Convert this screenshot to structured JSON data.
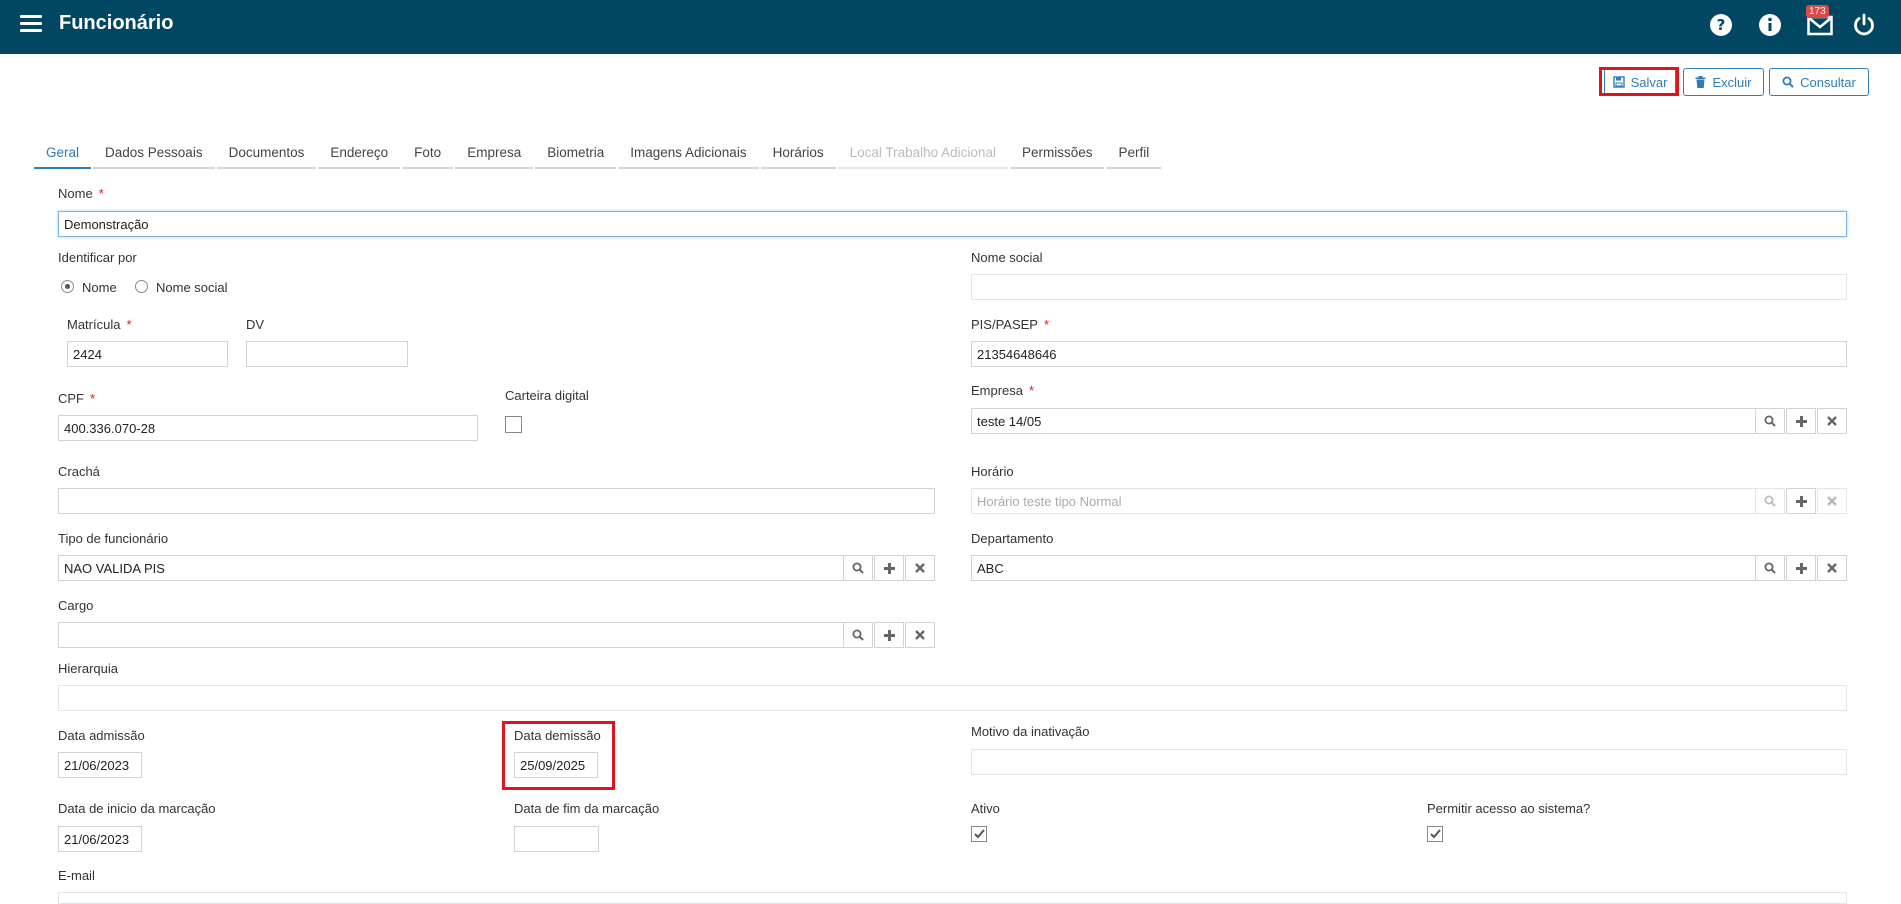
{
  "header": {
    "title": "Funcionário",
    "notifications_count": "173"
  },
  "toolbar": {
    "save_label": "Salvar",
    "delete_label": "Excluir",
    "search_label": "Consultar"
  },
  "tabs": [
    "Geral",
    "Dados Pessoais",
    "Documentos",
    "Endereço",
    "Foto",
    "Empresa",
    "Biometria",
    "Imagens Adicionais",
    "Horários",
    "Local Trabalho Adicional",
    "Permissões",
    "Perfil"
  ],
  "form": {
    "nome": {
      "label": "Nome",
      "value": "Demonstração"
    },
    "identificar_por": {
      "label": "Identificar por",
      "option_nome": "Nome",
      "option_social": "Nome social"
    },
    "nome_social": {
      "label": "Nome social",
      "value": ""
    },
    "matricula": {
      "label": "Matrícula",
      "value": "2424"
    },
    "dv": {
      "label": "DV",
      "value": ""
    },
    "pis": {
      "label": "PIS/PASEP",
      "value": "21354648646"
    },
    "cpf": {
      "label": "CPF",
      "value": "400.336.070-28"
    },
    "carteira": {
      "label": "Carteira digital"
    },
    "empresa": {
      "label": "Empresa",
      "value": "teste 14/05"
    },
    "cracha": {
      "label": "Crachá",
      "value": ""
    },
    "horario": {
      "label": "Horário",
      "value": "Horário teste tipo Normal"
    },
    "tipo": {
      "label": "Tipo de funcionário",
      "value": "NAO VALIDA PIS"
    },
    "departamento": {
      "label": "Departamento",
      "value": "ABC"
    },
    "cargo": {
      "label": "Cargo",
      "value": ""
    },
    "hierarquia": {
      "label": "Hierarquia",
      "value": ""
    },
    "admissao": {
      "label": "Data admissão",
      "value": "21/06/2023"
    },
    "demissao": {
      "label": "Data demissão",
      "value": "25/09/2025"
    },
    "motivo": {
      "label": "Motivo da inativação",
      "value": ""
    },
    "inicio_marcacao": {
      "label": "Data de inicio da marcação",
      "value": "21/06/2023"
    },
    "fim_marcacao": {
      "label": "Data de fim da marcação",
      "value": ""
    },
    "ativo": {
      "label": "Ativo",
      "checked": true
    },
    "acesso": {
      "label": "Permitir acesso ao sistema?",
      "checked": true
    },
    "email": {
      "label": "E-mail",
      "value": ""
    }
  }
}
